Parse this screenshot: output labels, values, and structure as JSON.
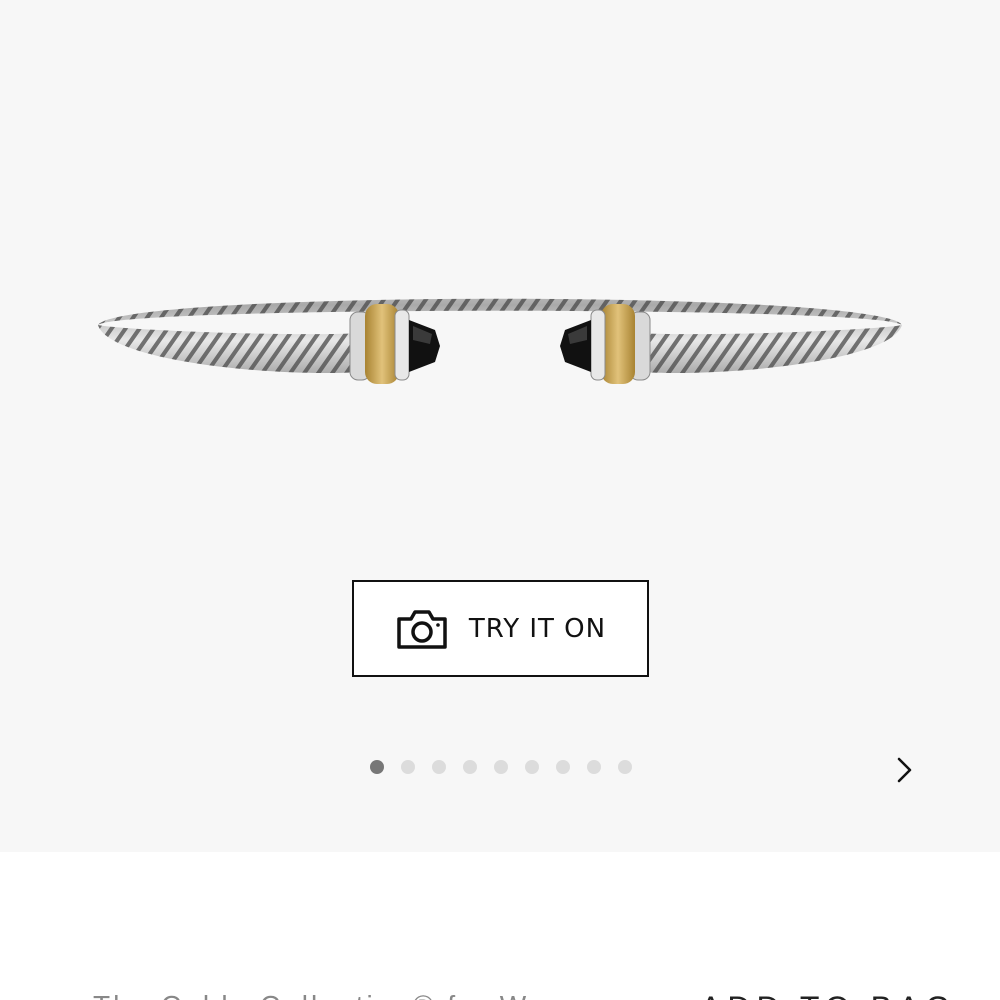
{
  "gallery": {
    "image_alt": "Cable bracelet with black onyx and 18K gold",
    "try_on_label": "TRY IT ON",
    "try_on_icon": "camera-icon",
    "dots_total": 9,
    "active_dot": 1,
    "next_icon": "chevron-right-icon"
  },
  "product": {
    "name_partial": "The Cable Collection® for Women",
    "cta_partial": "ADD TO BAG"
  },
  "colors": {
    "gallery_bg": "#f7f7f7",
    "silver": "#c8c8c8",
    "gold": "#c9a24a",
    "onyx": "#111111"
  }
}
